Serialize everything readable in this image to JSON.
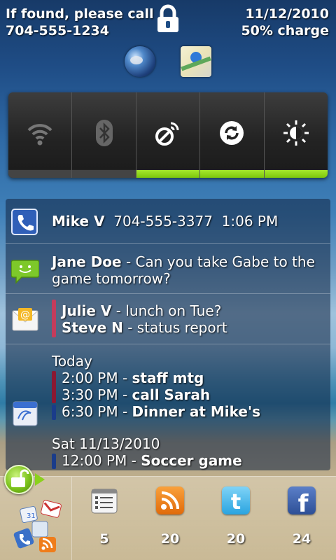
{
  "status": {
    "owner_line1": "If found, please call",
    "owner_line2": "704-555-1234",
    "date": "11/12/2010",
    "battery": "50% charge"
  },
  "icons": {
    "lock": "lock-icon",
    "browser": "globe-icon",
    "maps": "maps-icon"
  },
  "power_control": [
    {
      "name": "wifi",
      "on": false
    },
    {
      "name": "bluetooth",
      "on": false
    },
    {
      "name": "gps",
      "on": true
    },
    {
      "name": "sync",
      "on": true
    },
    {
      "name": "brightness",
      "on": true
    }
  ],
  "colors": {
    "power_on": "#8bd11d",
    "power_off": "#444444",
    "email_bar": "#c43c5c",
    "calendar_bar_dark": "#8a1832",
    "calendar_bar_blue": "#1a3c8a"
  },
  "call": {
    "name": "Mike V",
    "number": "704-555-3377",
    "time": "1:06 PM"
  },
  "sms": {
    "sender": "Jane Doe",
    "separator": " - ",
    "message_line1": "Can you take Gabe to the",
    "message_line2": "game tomorrow?"
  },
  "emails": [
    {
      "sender": "Julie V",
      "subject": "lunch on Tue?"
    },
    {
      "sender": "Steve N",
      "subject": "status report"
    }
  ],
  "calendar": {
    "today_label": "Today",
    "today_events": [
      {
        "time": "2:00 PM",
        "title": "staff mtg"
      },
      {
        "time": "3:30 PM",
        "title": "call Sarah"
      },
      {
        "time": "6:30 PM",
        "title": "Dinner at Mike's"
      }
    ],
    "next_label": "Sat 11/13/2010",
    "next_events": [
      {
        "time": "12:00 PM",
        "title": "Soccer game"
      }
    ]
  },
  "dock": [
    {
      "name": "tasks",
      "count": "5"
    },
    {
      "name": "rss",
      "count": "20"
    },
    {
      "name": "twitter",
      "count": "20"
    },
    {
      "name": "facebook",
      "count": "24"
    }
  ]
}
